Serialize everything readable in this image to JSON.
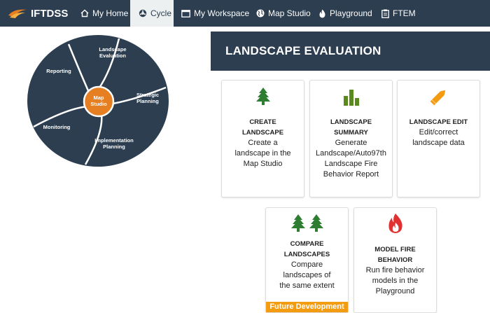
{
  "brand": {
    "name": "IFTDSS"
  },
  "nav": {
    "items": [
      {
        "label": "My Home",
        "icon": "home-icon"
      },
      {
        "label": "Cycle",
        "icon": "cycle-icon"
      },
      {
        "label": "My Workspace",
        "icon": "workspace-icon"
      },
      {
        "label": "Map Studio",
        "icon": "globe-icon"
      },
      {
        "label": "Playground",
        "icon": "fire-icon"
      },
      {
        "label": "FTEM",
        "icon": "clipboard-icon"
      }
    ],
    "active": "Cycle"
  },
  "cycle": {
    "center": [
      "Map",
      "Studio"
    ],
    "segments": {
      "landscape_evaluation": [
        "Landscape",
        "Evaluation"
      ],
      "strategic_planning": [
        "Strategic",
        "Planning"
      ],
      "implementation_planning": [
        "Implementation",
        "Planning"
      ],
      "monitoring": [
        "Monitoring"
      ],
      "reporting": [
        "Reporting"
      ]
    }
  },
  "section": {
    "title": "LANDSCAPE EVALUATION"
  },
  "cards": {
    "create_landscape": {
      "title": [
        "CREATE",
        "LANDSCAPE"
      ],
      "desc": [
        "Create a",
        "landscape in the",
        "Map Studio"
      ],
      "icon": "tree-icon"
    },
    "landscape_summary": {
      "title": [
        "LANDSCAPE",
        "SUMMARY"
      ],
      "desc": [
        "Generate",
        "Landscape/Auto97th",
        "Landscape Fire",
        "Behavior Report"
      ],
      "icon": "bar-chart-icon"
    },
    "landscape_edit": {
      "title": [
        "LANDSCAPE EDIT"
      ],
      "desc": [
        "Edit/correct",
        "landscape data"
      ],
      "icon": "pencil-icon"
    },
    "compare_landscapes": {
      "title": [
        "COMPARE",
        "LANDSCAPES"
      ],
      "desc": [
        "Compare",
        "landscapes of",
        "the same extent"
      ],
      "icon": "two-trees-icon",
      "badge": "Future Development"
    },
    "model_fire_behavior": {
      "title": [
        "MODEL FIRE",
        "BEHAVIOR"
      ],
      "desc": [
        "Run fire behavior",
        "models in the",
        "Playground"
      ],
      "icon": "fire-icon"
    }
  },
  "colors": {
    "navbar": "#2c3e50",
    "tree": "#2e7d32",
    "chart": "#5a8a1e",
    "pencil": "#f39c12",
    "fire": "#e03030",
    "center": "#e67e22",
    "badge": "#f39c12"
  }
}
